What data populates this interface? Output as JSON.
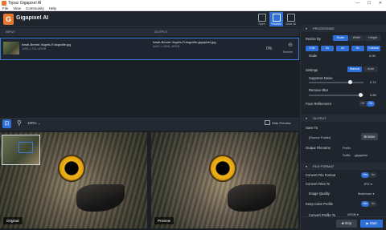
{
  "window": {
    "title": "Topaz Gigapixel AI",
    "controls": [
      "—",
      "☐",
      "✕"
    ]
  },
  "menu": [
    "File",
    "View",
    "Community",
    "Help"
  ],
  "header": {
    "app_name": "Gigapixel AI",
    "logo_letter": "G",
    "buttons": [
      {
        "label": "Open",
        "active": false
      },
      {
        "label": "Preview",
        "active": true
      },
      {
        "label": "Clear All",
        "active": false
      }
    ]
  },
  "table": {
    "col_input": "INPUT",
    "col_output": "OUTPUT",
    "row": {
      "input_name": "hawk-Bernie-Vogels-Fotografie.jpg",
      "input_meta": "1100 x 711, sRGB",
      "output_name": "hawk-Bernie-Vogels-Fotografie-gigapixel.jpg",
      "output_meta": "4400 x 2844, sRGB",
      "progress": "0%",
      "remove_label": "Remove"
    }
  },
  "viewbar": {
    "zoom": "100%",
    "hide_preview": "Hide Preview"
  },
  "preview": {
    "left_label": "Original",
    "right_label": "Preview"
  },
  "processing": {
    "title": "PROCESSING",
    "resize_by_label": "Resize By",
    "resize_options": [
      "Scale",
      "Width",
      "Height"
    ],
    "scale_options": [
      "0.5x",
      "2x",
      "4x",
      "6x",
      "Custom"
    ],
    "scale_label": "Scale",
    "scale_value": "4.00",
    "settings_label": "Settings",
    "settings_options": [
      "Manual",
      "Auto"
    ],
    "suppress_noise_label": "Suppress Noise",
    "suppress_noise_value": "0.71",
    "remove_blur_label": "Remove Blur",
    "remove_blur_value": "0.89",
    "face_refinement_label": "Face Refinement",
    "face_refinement_options": [
      "Off",
      "On"
    ]
  },
  "output": {
    "title": "OUTPUT",
    "save_to_label": "Save To",
    "save_to_value": "[Source Folder]",
    "browse_label": "Browse",
    "filename_label": "Output Filename",
    "prefix_label": "Prefix",
    "suffix_label": "Suffix",
    "suffix_value": "-gigapixel"
  },
  "file_format": {
    "title": "FILE FORMAT",
    "convert_format_label": "Convert File Format",
    "convert_format_options": [
      "Yes",
      "No"
    ],
    "convert_to_label": "Convert Files To",
    "convert_to_value": "JPG",
    "quality_label": "Image Quality",
    "quality_value": "Maximum",
    "keep_profile_label": "Keep Color Profile",
    "keep_profile_options": [
      "Yes",
      "No"
    ],
    "convert_profile_label": "Convert Profile To",
    "convert_profile_value": "sRGB"
  },
  "actions": {
    "stop": "Stop",
    "start": "Start"
  },
  "colors": {
    "accent": "#2e6fd8",
    "brand": "#e8772e",
    "panel": "#20252d"
  }
}
